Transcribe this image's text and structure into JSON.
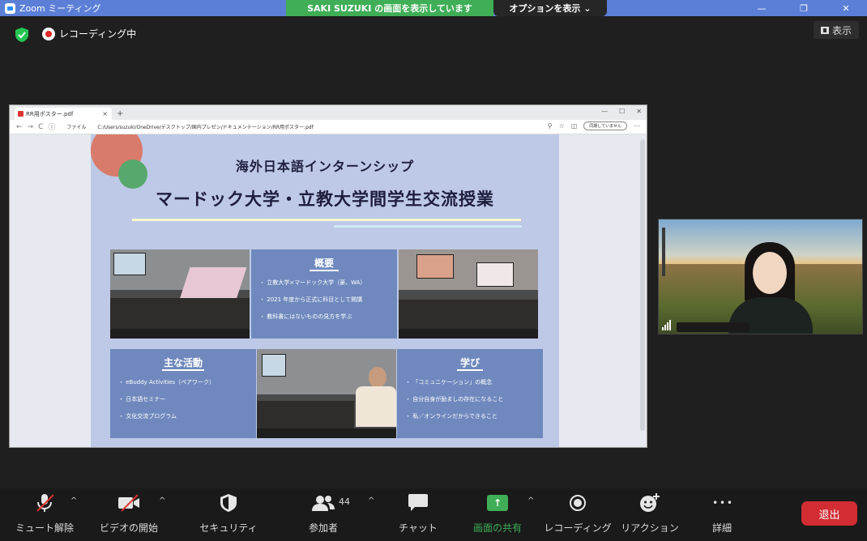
{
  "window": {
    "title": "Zoom ミーティング",
    "controls": [
      "—",
      "❐",
      "✕"
    ]
  },
  "share_banner": {
    "text": "SAKI SUZUKI の画面を表示しています",
    "options_label": "オプションを表示",
    "options_caret": "⌄"
  },
  "top": {
    "recording_label": "レコーディング中",
    "view_label": "表示"
  },
  "browser": {
    "tab_title": "RR用ポスター.pdf",
    "tab_close": "×",
    "new_tab": "+",
    "url_prefix": "ファイル",
    "url": "C:/Users/suzuki/OneDrive/デスクトップ/国内プレゼン/ドキュメンテーション/RR用ポスター.pdf",
    "sync_label": "同期していません",
    "nav_back": "←",
    "nav_forward": "→",
    "nav_reload": "C",
    "info_icon": "ⓘ",
    "right_icons": [
      "⚲",
      "☆",
      "◫"
    ],
    "menu_dots": "⋯",
    "win_controls": [
      "—",
      "☐",
      "✕"
    ]
  },
  "poster": {
    "subtitle": "海外日本語インターンシップ",
    "title": "マードック大学・立教大学間学生交流授業",
    "overview": {
      "heading": "概要",
      "items": [
        "立教大学×マードック大学（豪、WA）",
        "2021 年度から正式に科目として開講",
        "教科書にはないものの見方を学ぶ"
      ]
    },
    "activities": {
      "heading": "主な活動",
      "items": [
        "eBuddy Activities（ペアワーク）",
        "日本語セミナー",
        "文化交流プログラム"
      ]
    },
    "learning": {
      "heading": "学び",
      "items": [
        "「コミュニケーション」の概念",
        "自分自身が励ましの存在になること",
        "私／オンラインだからできること"
      ]
    }
  },
  "toolbar": {
    "mute_label": "ミュート解除",
    "video_label": "ビデオの開始",
    "security_label": "セキュリティ",
    "participants_label": "参加者",
    "participants_count": "44",
    "chat_label": "チャット",
    "share_label": "画面の共有",
    "record_label": "レコーディング",
    "reaction_label": "リアクション",
    "more_label": "詳細",
    "leave_label": "退出",
    "caret": "^",
    "share_arrow": "↑",
    "more_glyph": "• • •"
  },
  "colors": {
    "titlebar": "#5b7fd6",
    "share_green": "#3fae57",
    "leave_red": "#d12d32",
    "poster_bg": "#bdc9e6",
    "panel_blue": "#6f89be",
    "meeting_bg": "#1f1f1f"
  }
}
